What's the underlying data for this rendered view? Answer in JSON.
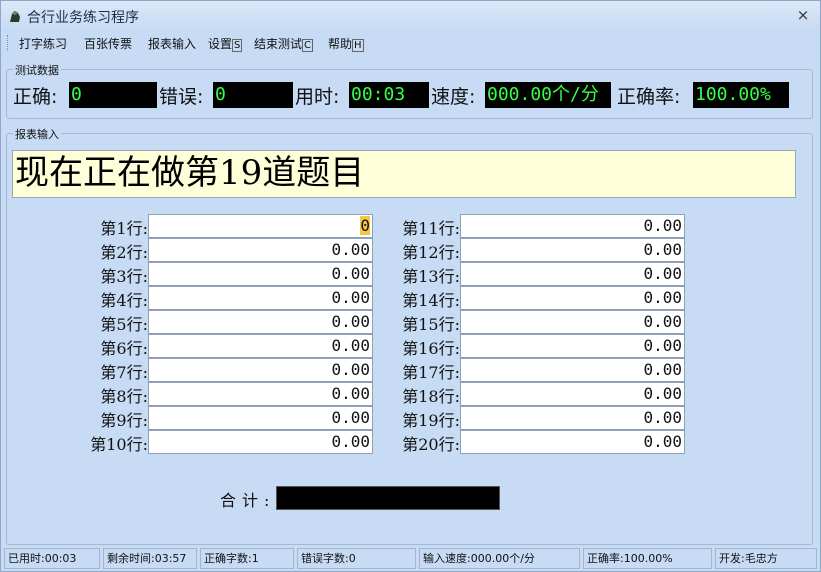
{
  "window": {
    "title": "合行业务练习程序",
    "close_glyph": "×"
  },
  "menu": {
    "typing": "打字练习",
    "bills": "百张传票",
    "report_input": "报表输入",
    "settings": "设置",
    "settings_key": "S",
    "end_test": "结束测试",
    "end_test_key": "C",
    "help": "帮助",
    "help_key": "H"
  },
  "test_data": {
    "group_title": "测试数据",
    "correct_label": "正确:",
    "correct_value": "0",
    "error_label": "错误:",
    "error_value": "0",
    "time_label": "用时:",
    "time_value": "00:03",
    "speed_label": "速度:",
    "speed_value": "000.00个/分",
    "accuracy_label": "正确率:",
    "accuracy_value": "100.00%"
  },
  "report": {
    "group_title": "报表输入",
    "banner": "现在正在做第19道题目",
    "rows_left": [
      {
        "label": "第1行:",
        "value": "0"
      },
      {
        "label": "第2行:",
        "value": "0.00"
      },
      {
        "label": "第3行:",
        "value": "0.00"
      },
      {
        "label": "第4行:",
        "value": "0.00"
      },
      {
        "label": "第5行:",
        "value": "0.00"
      },
      {
        "label": "第6行:",
        "value": "0.00"
      },
      {
        "label": "第7行:",
        "value": "0.00"
      },
      {
        "label": "第8行:",
        "value": "0.00"
      },
      {
        "label": "第9行:",
        "value": "0.00"
      },
      {
        "label": "第10行:",
        "value": "0.00"
      }
    ],
    "rows_right": [
      {
        "label": "第11行:",
        "value": "0.00"
      },
      {
        "label": "第12行:",
        "value": "0.00"
      },
      {
        "label": "第13行:",
        "value": "0.00"
      },
      {
        "label": "第14行:",
        "value": "0.00"
      },
      {
        "label": "第15行:",
        "value": "0.00"
      },
      {
        "label": "第16行:",
        "value": "0.00"
      },
      {
        "label": "第17行:",
        "value": "0.00"
      },
      {
        "label": "第18行:",
        "value": "0.00"
      },
      {
        "label": "第19行:",
        "value": "0.00"
      },
      {
        "label": "第20行:",
        "value": "0.00"
      }
    ],
    "total_label": "合计:",
    "total_value": ""
  },
  "status": {
    "elapsed": "已用时:00:03",
    "remaining": "剩余时间:03:57",
    "correct_chars": "正确字数:1",
    "error_chars": "错误字数:0",
    "input_speed": "输入速度:000.00个/分",
    "accuracy": "正确率:100.00%",
    "developer": "开发:毛忠方"
  },
  "colors": {
    "background": "#c7dbf5",
    "stat_text": "#33ff44",
    "banner_bg": "#fefed8",
    "highlight": "#f7c645"
  }
}
